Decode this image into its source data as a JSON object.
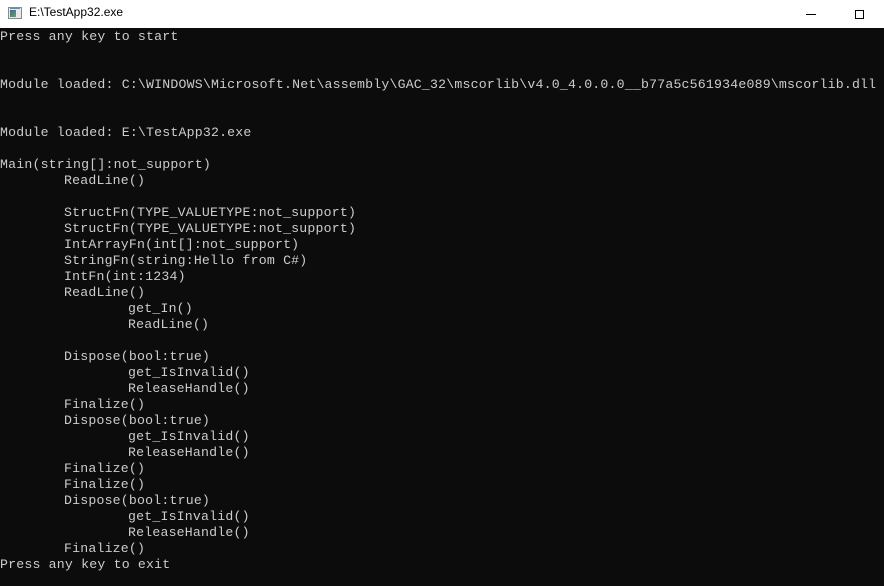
{
  "window": {
    "title": "E:\\TestApp32.exe",
    "icon": "console-app-icon",
    "buttons": [
      "minimize",
      "maximize"
    ]
  },
  "console": {
    "background": "#0c0c0c",
    "foreground": "#cccccc",
    "lines": [
      {
        "indent": 0,
        "text": "Press any key to start"
      },
      {
        "indent": 0,
        "text": ""
      },
      {
        "indent": 0,
        "text": ""
      },
      {
        "indent": 0,
        "text": "Module loaded: C:\\WINDOWS\\Microsoft.Net\\assembly\\GAC_32\\mscorlib\\v4.0_4.0.0.0__b77a5c561934e089\\mscorlib.dll"
      },
      {
        "indent": 0,
        "text": ""
      },
      {
        "indent": 0,
        "text": ""
      },
      {
        "indent": 0,
        "text": "Module loaded: E:\\TestApp32.exe"
      },
      {
        "indent": 0,
        "text": ""
      },
      {
        "indent": 0,
        "text": "Main(string[]:not_support)"
      },
      {
        "indent": 1,
        "text": "ReadLine()"
      },
      {
        "indent": 0,
        "text": ""
      },
      {
        "indent": 1,
        "text": "StructFn(TYPE_VALUETYPE:not_support)"
      },
      {
        "indent": 1,
        "text": "StructFn(TYPE_VALUETYPE:not_support)"
      },
      {
        "indent": 1,
        "text": "IntArrayFn(int[]:not_support)"
      },
      {
        "indent": 1,
        "text": "StringFn(string:Hello from C#)"
      },
      {
        "indent": 1,
        "text": "IntFn(int:1234)"
      },
      {
        "indent": 1,
        "text": "ReadLine()"
      },
      {
        "indent": 2,
        "text": "get_In()"
      },
      {
        "indent": 2,
        "text": "ReadLine()"
      },
      {
        "indent": 0,
        "text": ""
      },
      {
        "indent": 1,
        "text": "Dispose(bool:true)"
      },
      {
        "indent": 2,
        "text": "get_IsInvalid()"
      },
      {
        "indent": 2,
        "text": "ReleaseHandle()"
      },
      {
        "indent": 1,
        "text": "Finalize()"
      },
      {
        "indent": 1,
        "text": "Dispose(bool:true)"
      },
      {
        "indent": 2,
        "text": "get_IsInvalid()"
      },
      {
        "indent": 2,
        "text": "ReleaseHandle()"
      },
      {
        "indent": 1,
        "text": "Finalize()"
      },
      {
        "indent": 1,
        "text": "Finalize()"
      },
      {
        "indent": 1,
        "text": "Dispose(bool:true)"
      },
      {
        "indent": 2,
        "text": "get_IsInvalid()"
      },
      {
        "indent": 2,
        "text": "ReleaseHandle()"
      },
      {
        "indent": 1,
        "text": "Finalize()"
      },
      {
        "indent": 0,
        "text": "Press any key to exit"
      }
    ]
  }
}
